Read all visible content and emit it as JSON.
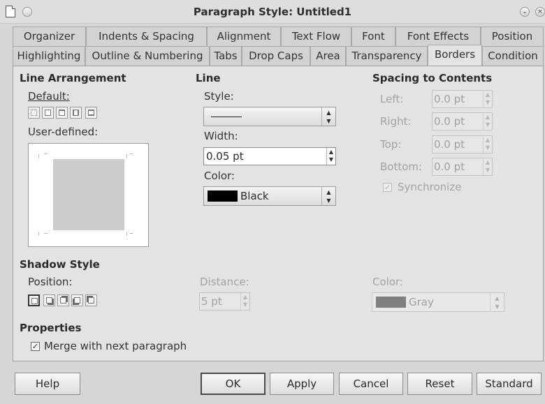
{
  "window": {
    "title": "Paragraph Style: Untitled1"
  },
  "tabs": {
    "row1": [
      "Organizer",
      "Indents & Spacing",
      "Alignment",
      "Text Flow",
      "Font",
      "Font Effects",
      "Position"
    ],
    "row2": [
      "Highlighting",
      "Outline & Numbering",
      "Tabs",
      "Drop Caps",
      "Area",
      "Transparency",
      "Borders",
      "Condition"
    ],
    "active": "Borders"
  },
  "line_arrangement": {
    "heading": "Line Arrangement",
    "default_label": "Default:",
    "user_defined_label": "User-defined:"
  },
  "line": {
    "heading": "Line",
    "style_label": "Style:",
    "width_label": "Width:",
    "width_value": "0.05 pt",
    "color_label": "Color:",
    "color_value": "Black",
    "color_swatch": "#000000"
  },
  "spacing": {
    "heading": "Spacing to Contents",
    "left_label": "Left:",
    "left_value": "0.0 pt",
    "right_label": "Right:",
    "right_value": "0.0 pt",
    "top_label": "Top:",
    "top_value": "0.0 pt",
    "bottom_label": "Bottom:",
    "bottom_value": "0.0 pt",
    "sync_label": "Synchronize",
    "sync_checked": true
  },
  "shadow": {
    "heading": "Shadow Style",
    "position_label": "Position:",
    "distance_label": "Distance:",
    "distance_value": "5 pt",
    "color_label": "Color:",
    "color_value": "Gray",
    "color_swatch": "#808080"
  },
  "properties": {
    "heading": "Properties",
    "merge_label": "Merge with next paragraph",
    "merge_checked": true
  },
  "buttons": {
    "help": "Help",
    "ok": "OK",
    "apply": "Apply",
    "cancel": "Cancel",
    "reset": "Reset",
    "standard": "Standard"
  }
}
